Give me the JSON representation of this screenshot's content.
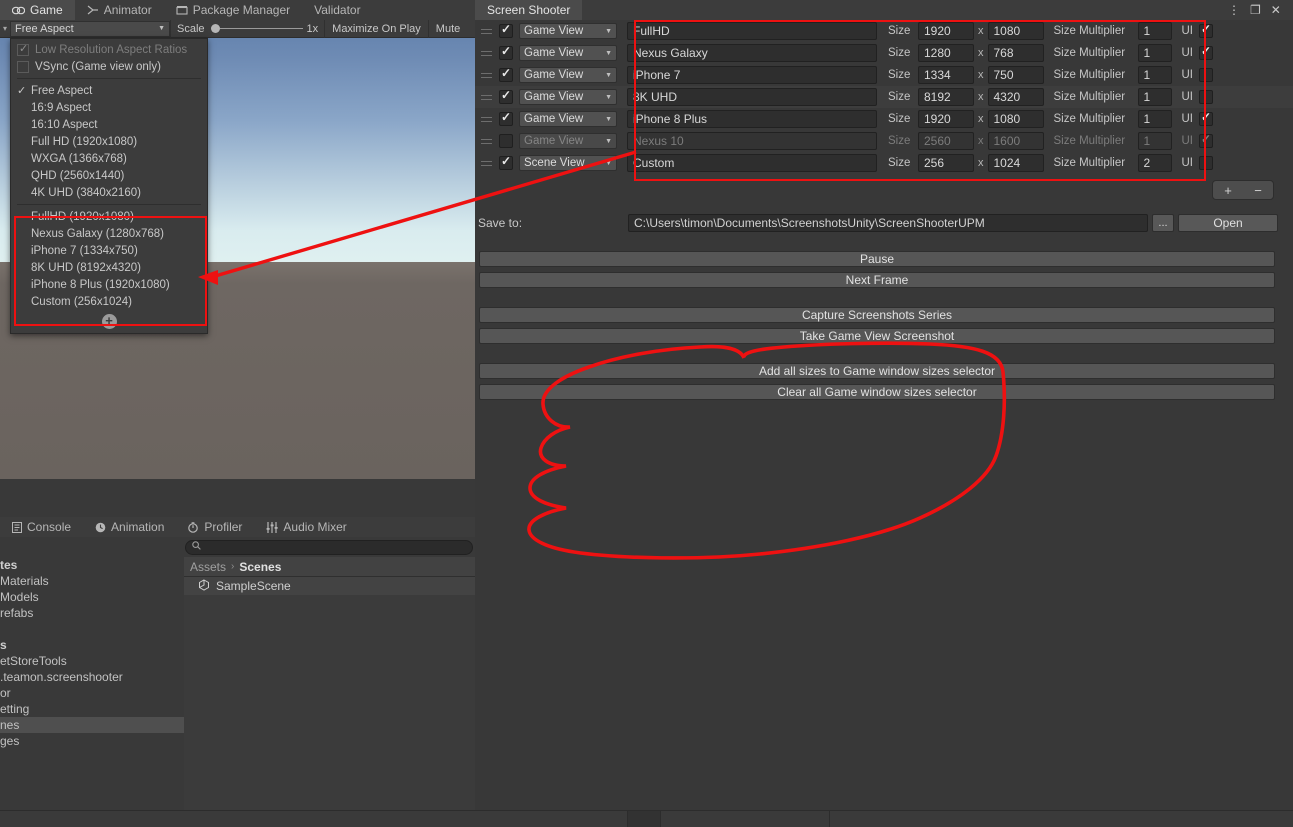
{
  "window": {
    "controls": [
      {
        "name": "kebab-menu-icon",
        "glyph": "⋮"
      },
      {
        "name": "maximize-icon",
        "glyph": "❐"
      },
      {
        "name": "close-icon",
        "glyph": "✕"
      }
    ]
  },
  "game_panel": {
    "tabs": [
      {
        "label": "Game",
        "icon": "gamepad-icon",
        "active": true
      },
      {
        "label": "Animator",
        "icon": "animator-icon",
        "active": false
      },
      {
        "label": "Package Manager",
        "icon": "package-icon",
        "active": false
      },
      {
        "label": "Validator",
        "icon": "",
        "active": false
      }
    ],
    "toolbar": {
      "aspect_value": "Free Aspect",
      "scale_label": "Scale",
      "scale_value": "1x",
      "maximize_on_play": "Maximize On Play",
      "mute_audio": "Mute"
    }
  },
  "aspect_menu": {
    "options_top": [
      {
        "label": "Low Resolution Aspect Ratios",
        "type": "checkbox",
        "checked": true,
        "disabled": true
      },
      {
        "label": "VSync (Game view only)",
        "type": "checkbox",
        "checked": false,
        "disabled": false
      }
    ],
    "builtin": [
      {
        "label": "Free Aspect",
        "selected": true
      },
      {
        "label": "16:9 Aspect",
        "selected": false
      },
      {
        "label": "16:10 Aspect",
        "selected": false
      },
      {
        "label": "Full HD (1920x1080)",
        "selected": false
      },
      {
        "label": "WXGA (1366x768)",
        "selected": false
      },
      {
        "label": "QHD (2560x1440)",
        "selected": false
      },
      {
        "label": "4K UHD (3840x2160)",
        "selected": false
      }
    ],
    "custom_presets": [
      {
        "label": "FullHD (1920x1080)"
      },
      {
        "label": "Nexus Galaxy (1280x768)"
      },
      {
        "label": "iPhone 7 (1334x750)"
      },
      {
        "label": "8K UHD (8192x4320)"
      },
      {
        "label": "iPhone 8 Plus (1920x1080)"
      },
      {
        "label": "Custom (256x1024)"
      }
    ],
    "add_button": "+"
  },
  "screen_shooter": {
    "tab_label": "Screen Shooter",
    "column_labels": {
      "size": "Size",
      "x": "x",
      "size_multiplier": "Size Multiplier",
      "ui": "UI"
    },
    "rows": [
      {
        "enabled": true,
        "view": "Game View",
        "name": "FullHD",
        "width": "1920",
        "height": "1080",
        "multiplier": "1",
        "ui": true,
        "disabled": false,
        "alt": false
      },
      {
        "enabled": true,
        "view": "Game View",
        "name": "Nexus Galaxy",
        "width": "1280",
        "height": "768",
        "multiplier": "1",
        "ui": true,
        "disabled": false,
        "alt": false
      },
      {
        "enabled": true,
        "view": "Game View",
        "name": "iPhone 7",
        "width": "1334",
        "height": "750",
        "multiplier": "1",
        "ui": false,
        "disabled": false,
        "alt": false
      },
      {
        "enabled": true,
        "view": "Game View",
        "name": "8K UHD",
        "width": "8192",
        "height": "4320",
        "multiplier": "1",
        "ui": false,
        "disabled": false,
        "alt": true
      },
      {
        "enabled": true,
        "view": "Game View",
        "name": "iPhone 8 Plus",
        "width": "1920",
        "height": "1080",
        "multiplier": "1",
        "ui": true,
        "disabled": false,
        "alt": false
      },
      {
        "enabled": false,
        "view": "Game View",
        "name": "Nexus 10",
        "width": "2560",
        "height": "1600",
        "multiplier": "1",
        "ui": true,
        "disabled": true,
        "alt": false
      },
      {
        "enabled": true,
        "view": "Scene View",
        "name": "Custom",
        "width": "256",
        "height": "1024",
        "multiplier": "2",
        "ui": false,
        "disabled": false,
        "alt": false
      }
    ],
    "add_label": "+",
    "remove_label": "−",
    "save_to_label": "Save to:",
    "save_path": "C:\\Users\\timon\\Documents\\ScreenshotsUnity\\ScreenShooterUPM",
    "browse_label": "...",
    "open_label": "Open",
    "buttons": [
      {
        "label": "Pause",
        "name": "pause-button"
      },
      {
        "label": "Next Frame",
        "name": "next-frame-button"
      },
      {
        "label": "Capture Screenshots Series",
        "name": "capture-series-button"
      },
      {
        "label": "Take Game View Screenshot",
        "name": "take-screenshot-button"
      },
      {
        "label": "Add all sizes to Game window sizes selector",
        "name": "add-all-sizes-button"
      },
      {
        "label": "Clear all Game window sizes selector",
        "name": "clear-all-sizes-button"
      }
    ]
  },
  "bottom_panel": {
    "tabs": [
      {
        "label": "Console",
        "icon": "console-icon"
      },
      {
        "label": "Animation",
        "icon": "clock-icon"
      },
      {
        "label": "Profiler",
        "icon": "stopwatch-icon"
      },
      {
        "label": "Audio Mixer",
        "icon": "mixer-icon"
      }
    ],
    "search_placeholder": "",
    "search_icon": "search-icon",
    "tree_items": [
      {
        "label": "tes",
        "bold": true,
        "selected": false
      },
      {
        "label": "Materials",
        "bold": false,
        "selected": false
      },
      {
        "label": "Models",
        "bold": false,
        "selected": false
      },
      {
        "label": "refabs",
        "bold": false,
        "selected": false
      },
      {
        "label": "",
        "bold": false,
        "selected": false
      },
      {
        "label": "s",
        "bold": true,
        "selected": false
      },
      {
        "label": "etStoreTools",
        "bold": false,
        "selected": false
      },
      {
        "label": ".teamon.screenshooter",
        "bold": false,
        "selected": false
      },
      {
        "label": "or",
        "bold": false,
        "selected": false
      },
      {
        "label": "etting",
        "bold": false,
        "selected": false
      },
      {
        "label": "nes",
        "bold": false,
        "selected": true
      },
      {
        "label": "ges",
        "bold": false,
        "selected": false
      }
    ],
    "breadcrumb": {
      "root": "Assets",
      "separator": "›",
      "current": "Scenes"
    },
    "assets": [
      {
        "label": "SampleScene",
        "icon": "unity-scene-icon"
      }
    ]
  },
  "colors": {
    "annotation_red": "#ee1111",
    "panel_bg": "#383838",
    "toolbar_bg": "#3c3c3c",
    "field_bg": "#2e2e2e",
    "button_bg": "#565656",
    "sky_top": "#5a7ba8",
    "sky_horizon": "#dff0f0",
    "ground": "#6e6762"
  }
}
